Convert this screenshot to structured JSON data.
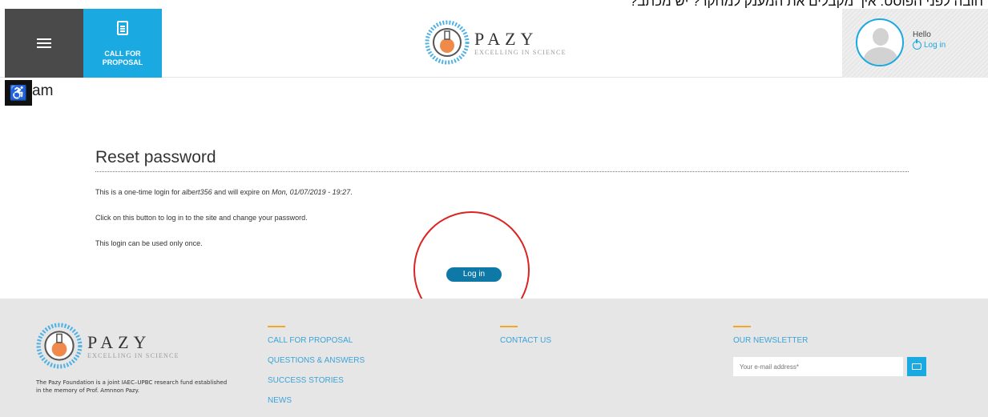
{
  "top_text": "חובה לפני הפוסט: איך מקבלים את המענק למחקר? יש מכתב?",
  "header": {
    "cfp_label_line1": "CALL FOR",
    "cfp_label_line2": "PROPOSAL",
    "logo_name": "PAZY",
    "logo_tagline": "EXCELLING IN SCIENCE",
    "hello": "Hello",
    "login_link": "Log in"
  },
  "spam_text": "am",
  "main": {
    "title": "Reset password",
    "msg1_prefix": "This is a one-time login for ",
    "msg1_user": "albert356",
    "msg1_mid": " and will expire on ",
    "msg1_date": "Mon, 01/07/2019 - 19:27",
    "msg1_suffix": ".",
    "msg2": "Click on this button to log in to the site and change your password.",
    "msg3": "This login can be used only once.",
    "login_button": "Log in"
  },
  "footer": {
    "logo_name": "PAZY",
    "logo_tagline": "EXCELLING IN SCIENCE",
    "description": "The Pazy Foundation is a joint IAEC–UPBC research fund established in the memory of Prof. Amnnon Pazy.",
    "col1": [
      "CALL FOR PROPOSAL",
      "QUESTIONS & ANSWERS",
      "SUCCESS STORIES",
      "NEWS"
    ],
    "col2": [
      "CONTACT US"
    ],
    "col3_heading": "OUR NEWSLETTER",
    "newsletter_placeholder": "Your e-mail address*"
  },
  "colors": {
    "accent_blue": "#1aa9e0",
    "button_blue": "#0e79a6",
    "annotation_red": "#dd2222",
    "footer_accent": "#f5a623"
  }
}
